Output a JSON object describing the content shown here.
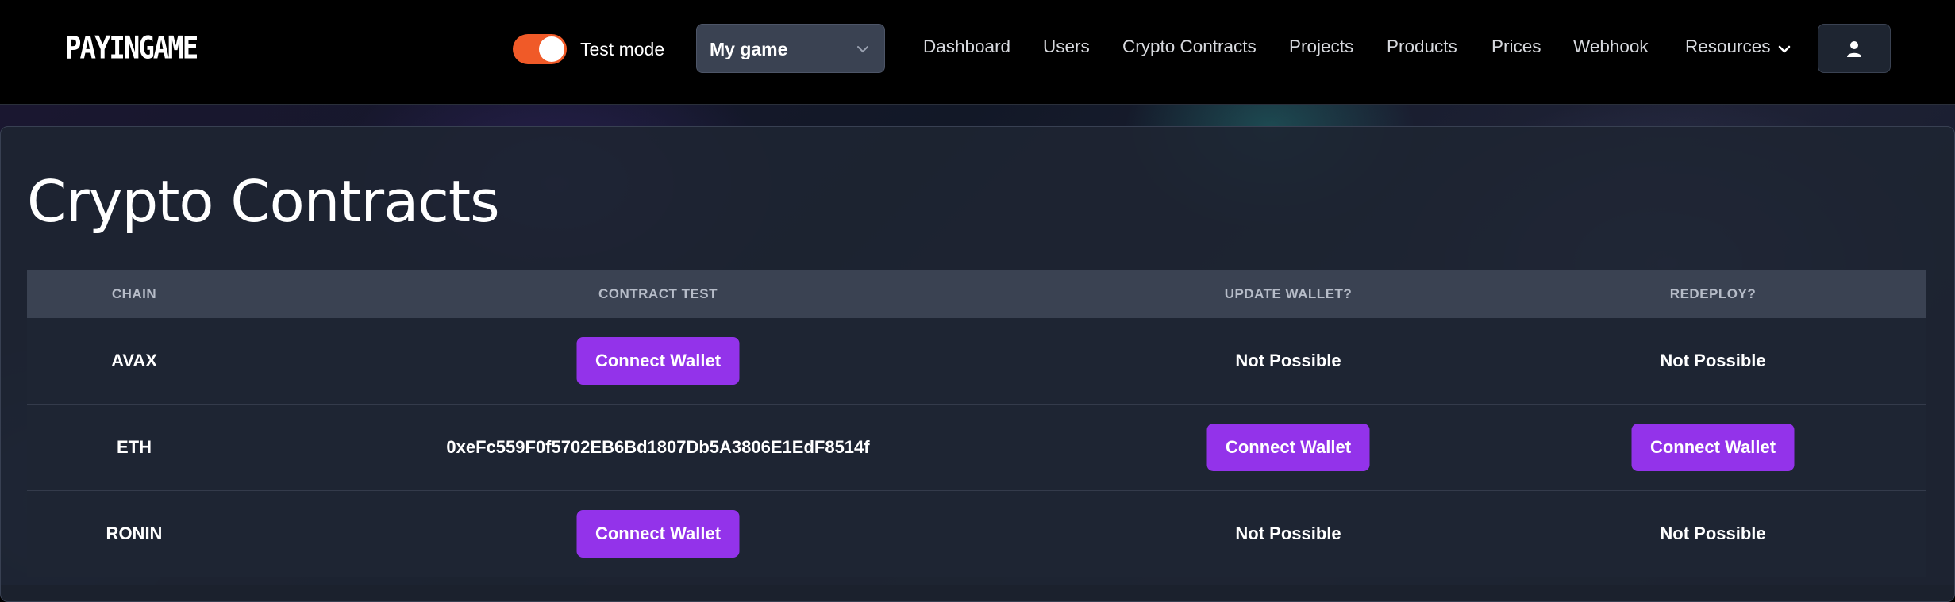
{
  "header": {
    "logo": "PAYINGAME",
    "test_mode_label": "Test mode",
    "test_mode_on": true,
    "game_select_value": "My game",
    "nav": [
      "Dashboard",
      "Users",
      "Crypto Contracts",
      "Projects",
      "Products",
      "Prices",
      "Webhook",
      "Resources"
    ],
    "accent_color": "#f05a28"
  },
  "main": {
    "title": "Crypto Contracts",
    "table": {
      "columns": [
        "CHAIN",
        "CONTRACT TEST",
        "UPDATE WALLET?",
        "REDEPLOY?"
      ],
      "rows": [
        {
          "chain": "AVAX",
          "contract_test": "Connect Wallet",
          "update_wallet": "Not Possible",
          "redeploy": "Not Possible"
        },
        {
          "chain": "ETH",
          "contract_test": "0xeFc559F0f5702EB6Bd1807Db5A3806E1EdF8514f",
          "update_wallet": "Connect Wallet",
          "redeploy": "Connect Wallet"
        },
        {
          "chain": "RONIN",
          "contract_test": "Connect Wallet",
          "update_wallet": "Not Possible",
          "redeploy": "Not Possible"
        }
      ]
    },
    "button_color": "#9333ea"
  }
}
